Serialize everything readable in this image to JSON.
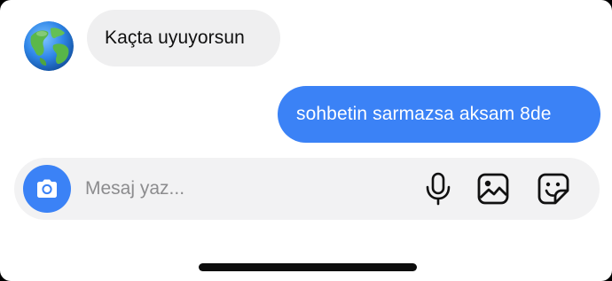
{
  "conversation": {
    "incoming_message": "Kaçta uyuyorsun",
    "outgoing_message": "sohbetin sarmazsa aksam 8de"
  },
  "composer": {
    "placeholder": "Mesaj yaz..."
  },
  "icons": {
    "avatar": "globe-avatar-icon",
    "camera": "camera-icon",
    "microphone": "microphone-icon",
    "gallery": "image-gallery-icon",
    "sticker": "sticker-icon"
  },
  "colors": {
    "accent": "#3b82f6",
    "incoming_bubble": "#efeff0",
    "composer_background": "#f2f2f3"
  }
}
